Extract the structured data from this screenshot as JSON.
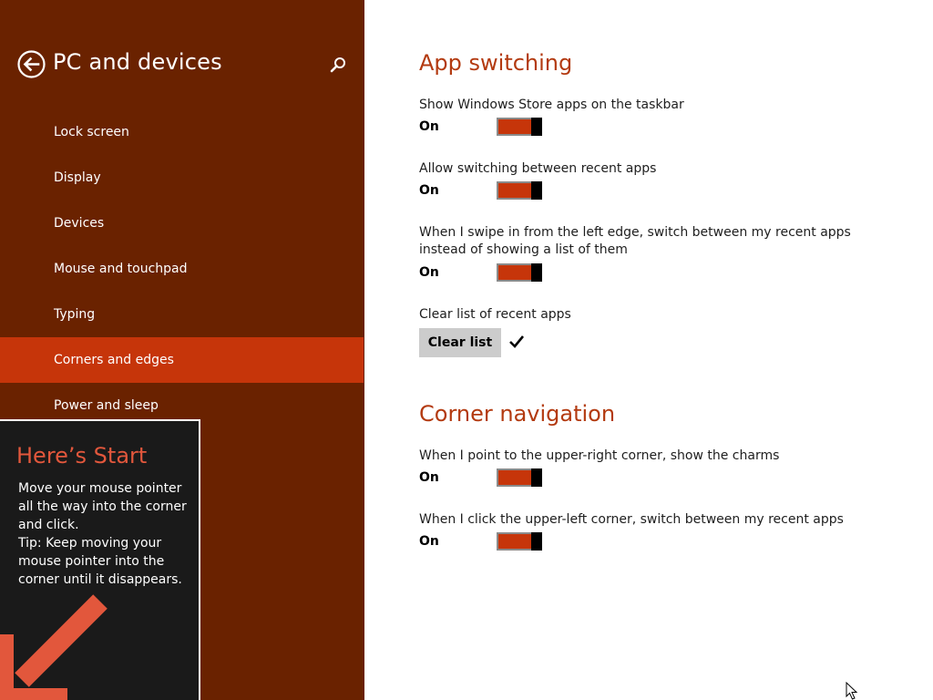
{
  "sidebar": {
    "title": "PC and devices",
    "back_icon": "back-arrow-icon",
    "search_icon": "search-icon",
    "items": [
      {
        "label": "Lock screen",
        "selected": false
      },
      {
        "label": "Display",
        "selected": false
      },
      {
        "label": "Devices",
        "selected": false
      },
      {
        "label": "Mouse and touchpad",
        "selected": false
      },
      {
        "label": "Typing",
        "selected": false
      },
      {
        "label": "Corners and edges",
        "selected": true
      },
      {
        "label": "Power and sleep",
        "selected": false
      }
    ]
  },
  "start_tip": {
    "title": "Here’s Start",
    "lines": [
      "Move your mouse pointer",
      "all the way into the corner",
      "and click.",
      "Tip: Keep moving your",
      "mouse pointer into the",
      "corner until it disappears."
    ],
    "arrow_icon": "arrow-down-left-icon"
  },
  "app_switching": {
    "heading": "App switching",
    "settings": [
      {
        "label": "Show Windows Store apps on the taskbar",
        "state": "On"
      },
      {
        "label": "Allow switching between recent apps",
        "state": "On"
      },
      {
        "label": "When I swipe in from the left edge, switch between my recent apps instead of showing a list of them",
        "state": "On"
      }
    ],
    "clear": {
      "label": "Clear list of recent apps",
      "button": "Clear list",
      "done_icon": "checkmark-icon"
    }
  },
  "corner_navigation": {
    "heading": "Corner navigation",
    "settings": [
      {
        "label": "When I point to the upper-right corner, show the charms",
        "state": "On"
      },
      {
        "label": "When I click the upper-left corner, switch between my recent apps",
        "state": "On"
      }
    ]
  },
  "colors": {
    "sidebar_bg": "#6a2200",
    "accent": "#c6350a",
    "heading": "#b33a10",
    "tip_bg": "#1a1a1a",
    "tip_title": "#e2573c"
  }
}
